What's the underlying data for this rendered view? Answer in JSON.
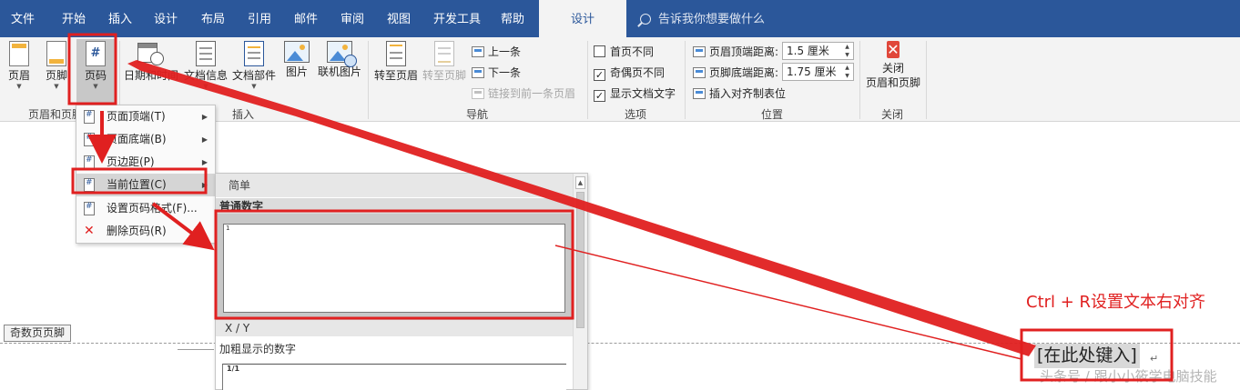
{
  "tabs": {
    "file": "文件",
    "home": "开始",
    "insert": "插入",
    "design": "设计",
    "layout": "布局",
    "references": "引用",
    "mailings": "邮件",
    "review": "审阅",
    "view": "视图",
    "developer": "开发工具",
    "help": "帮助",
    "hf_design": "设计"
  },
  "tell_me": "告诉我你想要做什么",
  "ribbon": {
    "header": "页眉",
    "footer": "页脚",
    "page_number": "页码",
    "group_hf": "页眉和页脚",
    "date_time": "日期和时间",
    "doc_info": "文档信息",
    "quick_parts": "文档部件",
    "pictures": "图片",
    "online_pictures": "联机图片",
    "group_insert": "插入",
    "goto_header": "转至页眉",
    "goto_footer": "转至页脚",
    "previous": "上一条",
    "next": "下一条",
    "link_previous": "链接到前一条页眉",
    "group_nav": "导航",
    "diff_first": "首页不同",
    "diff_odd_even": "奇偶页不同",
    "show_doc_text": "显示文档文字",
    "group_options": "选项",
    "header_from_top_label": "页眉顶端距离:",
    "header_from_top_value": "1.5 厘米",
    "footer_from_bottom_label": "页脚底端距离:",
    "footer_from_bottom_value": "1.75 厘米",
    "insert_align_tab": "插入对齐制表位",
    "group_position": "位置",
    "close_line1": "关闭",
    "close_line2": "页眉和页脚",
    "group_close": "关闭"
  },
  "options_state": {
    "diff_first": false,
    "diff_odd_even": true,
    "show_doc_text": true
  },
  "menu": {
    "top_of_page": "页面顶端(T)",
    "bottom_of_page": "页面底端(B)",
    "page_margins": "页边距(P)",
    "current_position": "当前位置(C)",
    "format_page_numbers": "设置页码格式(F)...",
    "remove_page_numbers": "删除页码(R)"
  },
  "gallery": {
    "header": "简单",
    "section_plain": "普通数字",
    "thumb1_text": "1",
    "section_xy": "X / Y",
    "section_bold": "加粗显示的数字",
    "thumb2_text": "1/1"
  },
  "document": {
    "odd_header_label": "奇数页页脚",
    "placeholder": "[在此处键入]",
    "paragraph_mark": "↵",
    "annotation": "Ctrl + R设置文本右对齐",
    "watermark": "头条号 / 跟小小筱学电脑技能"
  },
  "colors": {
    "tab_bar": "#2b579a",
    "ribbon_bg": "#f3f3f3",
    "annotation_red": "#e02020",
    "close_red": "#e0473a"
  },
  "icons": {
    "header": "page-header-icon",
    "footer": "page-footer-icon",
    "page_number": "page-number-icon",
    "date_time": "calendar-clock-icon",
    "doc_info": "document-info-icon",
    "quick_parts": "quick-parts-icon",
    "pictures": "picture-icon",
    "online_pictures": "online-picture-icon",
    "close": "close-x-icon",
    "search": "search-icon"
  }
}
